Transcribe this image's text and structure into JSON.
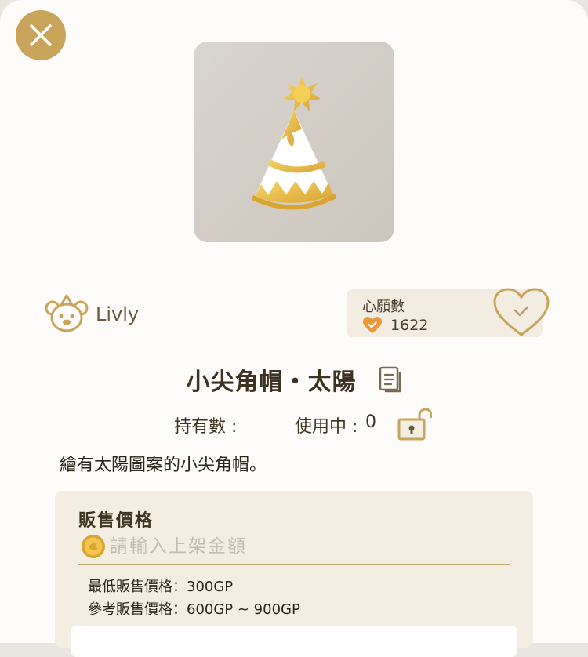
{
  "item": {
    "name": "小尖角帽・太陽",
    "description": "繪有太陽圖案的小尖角帽。",
    "brand": "Livly"
  },
  "wishlist": {
    "label": "心願數",
    "count": "1622"
  },
  "stats": {
    "owned_label": "持有數 :",
    "owned_value": "",
    "in_use_label": "使用中 :",
    "in_use_value": "0"
  },
  "sell": {
    "title": "販售價格",
    "input_placeholder": "請輸入上架金額",
    "min_price": "最低販售價格：300GP",
    "ref_price": "參考販售價格：600GP ~ 900GP"
  },
  "icons": {
    "close": "close-icon",
    "brand": "livly-logo-icon",
    "wish": "heart-check-icon",
    "copy": "copy-icon",
    "lock": "unlock-icon",
    "coin": "gold-coin-icon"
  },
  "colors": {
    "accent_gold": "#c9a55b",
    "panel_beige": "#f4ede2",
    "text_dark": "#3e3221",
    "heart_orange": "#e89a3c"
  }
}
